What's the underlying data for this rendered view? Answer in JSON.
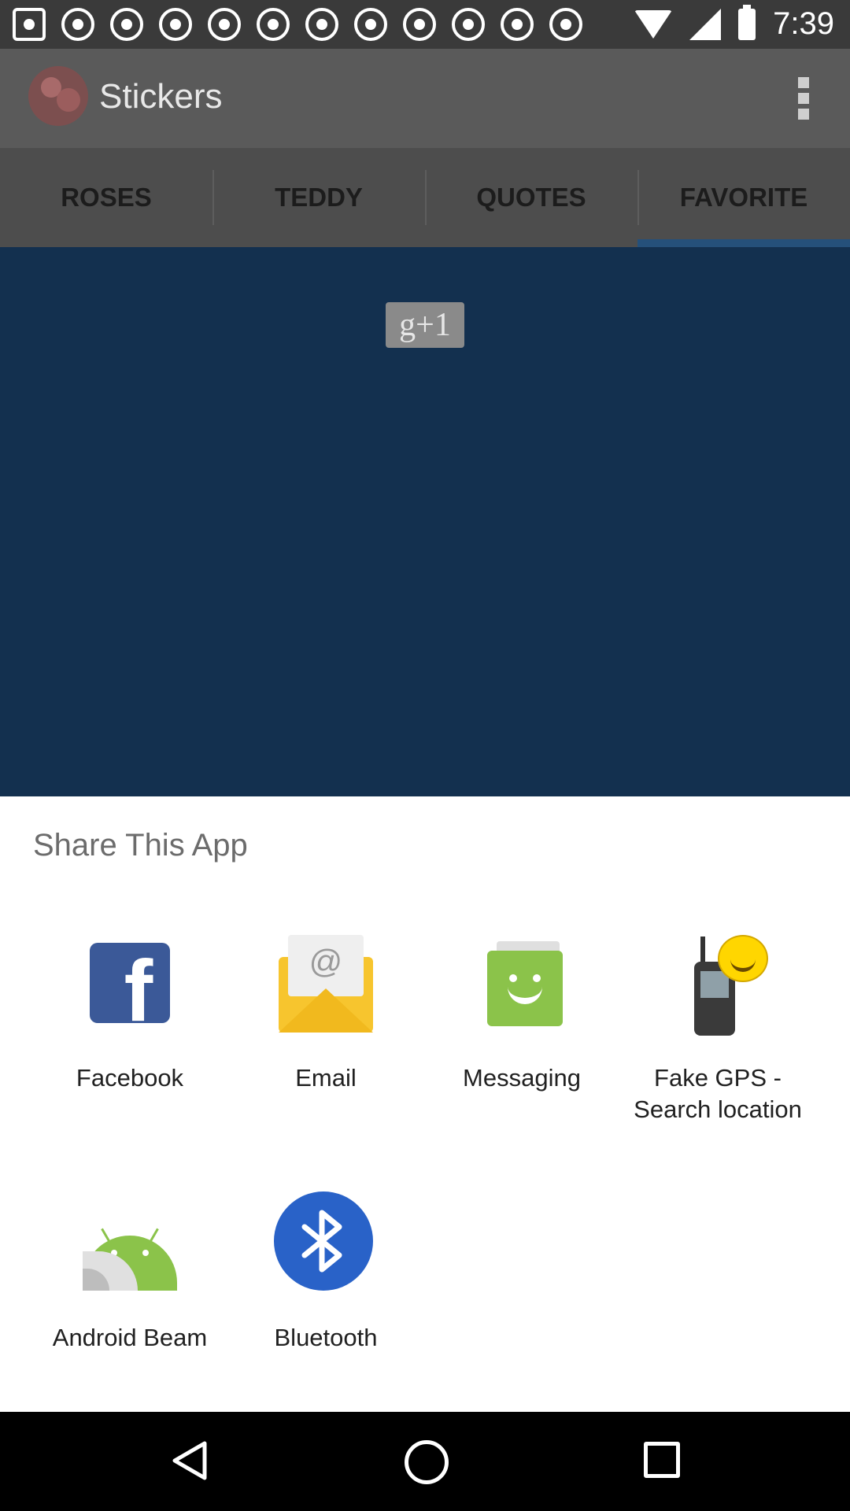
{
  "status_bar": {
    "time": "7:39",
    "notification_icons": [
      "notification-icon",
      "notification-icon",
      "notification-icon",
      "notification-icon",
      "notification-icon",
      "notification-icon",
      "notification-icon",
      "notification-icon",
      "notification-icon",
      "notification-icon",
      "notification-icon",
      "notification-icon"
    ]
  },
  "app_bar": {
    "title": "Stickers"
  },
  "tabs": [
    {
      "label": "ROSES"
    },
    {
      "label": "TEDDY"
    },
    {
      "label": "QUOTES"
    },
    {
      "label": "FAVORITE"
    }
  ],
  "content": {
    "gplus_label": "g+1"
  },
  "share_sheet": {
    "title": "Share This App",
    "apps": [
      {
        "label": "Facebook",
        "icon": "facebook-icon"
      },
      {
        "label": "Email",
        "icon": "email-icon"
      },
      {
        "label": "Messaging",
        "icon": "messaging-icon"
      },
      {
        "label": "Fake GPS - Search location",
        "icon": "fake-gps-icon"
      },
      {
        "label": "Android Beam",
        "icon": "android-beam-icon"
      },
      {
        "label": "Bluetooth",
        "icon": "bluetooth-icon"
      }
    ]
  },
  "colors": {
    "content_bg": "#13304f",
    "tab_indicator": "#25507a",
    "facebook": "#3b5998",
    "bluetooth": "#2962c8"
  }
}
